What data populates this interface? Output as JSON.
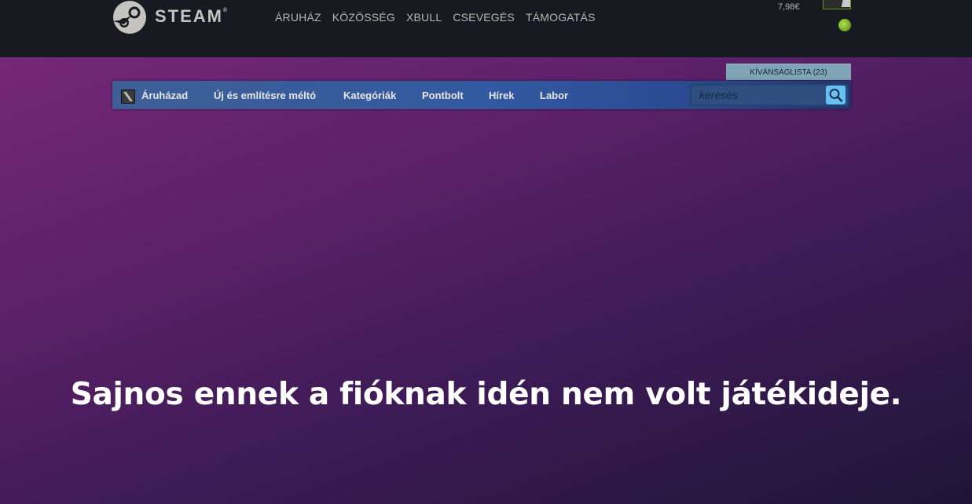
{
  "header": {
    "logo_text": "STEAM",
    "logo_reg": "®",
    "nav": [
      "ÁRUHÁZ",
      "KÖZÖSSÉG",
      "XBULL",
      "CSEVEGÉS",
      "TÁMOGATÁS"
    ],
    "wallet": "7,98€"
  },
  "store": {
    "wishlist_label": "KÍVÁNSÁGLISTA (23)",
    "nav": [
      "Áruházad",
      "Új és említésre méltó",
      "Kategóriák",
      "Pontbolt",
      "Hírek",
      "Labor"
    ],
    "search_placeholder": "keresés"
  },
  "main": {
    "headline": "Sajnos ennek a fióknak idén nem volt játékideje."
  },
  "colors": {
    "topbar": "#171a21",
    "nav_text": "#b8b6b4",
    "wishlist_bg": "#7ea4b5",
    "search_button": "#67c1f5",
    "online": "#8bc53f"
  }
}
